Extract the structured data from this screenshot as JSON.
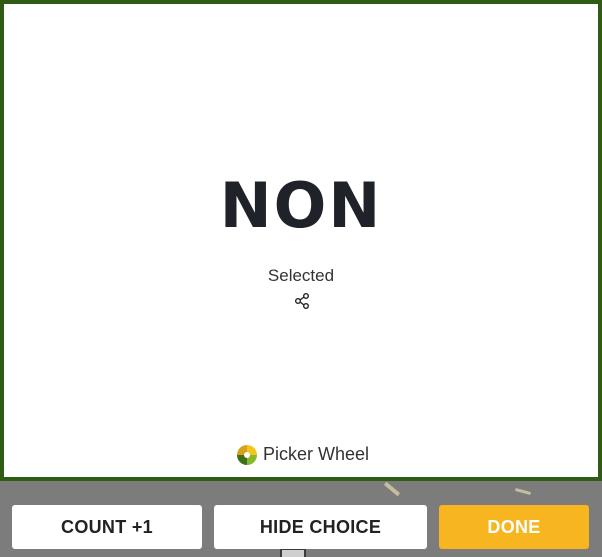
{
  "result": {
    "title": "NON",
    "status": "Selected"
  },
  "brand": {
    "name": "Picker Wheel",
    "logo_icon": "picker-wheel-logo-icon"
  },
  "icons": {
    "share": "share-icon"
  },
  "actions": {
    "count_label": "COUNT +1",
    "hide_label": "HIDE CHOICE",
    "done_label": "DONE"
  },
  "colors": {
    "card_border": "#2f5b14",
    "done_button": "#f7b51f",
    "overlay": "#7c7c7c"
  }
}
